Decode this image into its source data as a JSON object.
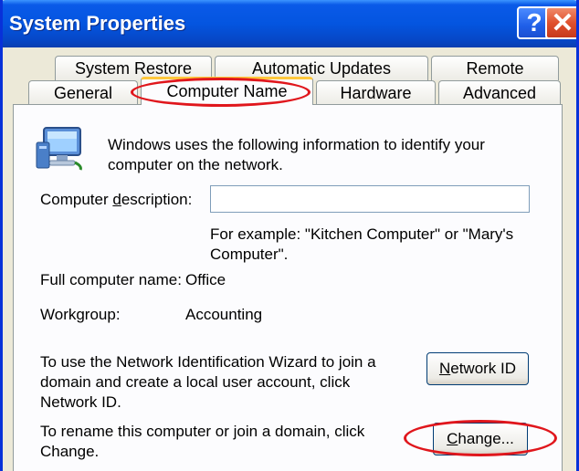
{
  "window": {
    "title": "System Properties"
  },
  "titlebar_buttons": {
    "help": "?",
    "close": "✕"
  },
  "tabs": {
    "row1": [
      "System Restore",
      "Automatic Updates",
      "Remote"
    ],
    "row2": [
      "General",
      "Computer Name",
      "Hardware",
      "Advanced"
    ],
    "active": "Computer Name"
  },
  "panel": {
    "intro": "Windows uses the following information to identify your computer on the network.",
    "description_label_pre": "Computer ",
    "description_label_access": "d",
    "description_label_post": "escription:",
    "description_value": "",
    "example_text": "For example: \"Kitchen Computer\" or \"Mary's Computer\".",
    "full_name_label": "Full computer name:",
    "full_name_value": "Office",
    "workgroup_label": "Workgroup:",
    "workgroup_value": "Accounting",
    "network_text": "To use the Network Identification Wizard to join a domain and create a local user account, click Network ID.",
    "network_button_access": "N",
    "network_button_rest": "etwork ID",
    "rename_text": "To rename this computer or join a domain, click Change.",
    "change_button_access": "C",
    "change_button_rest": "hange..."
  },
  "colors": {
    "titlebar": "#0455e0",
    "window_bg": "#ece9d8",
    "annotation": "#e0161c"
  },
  "icons": [
    "computer-network-icon",
    "help-icon",
    "close-icon"
  ]
}
